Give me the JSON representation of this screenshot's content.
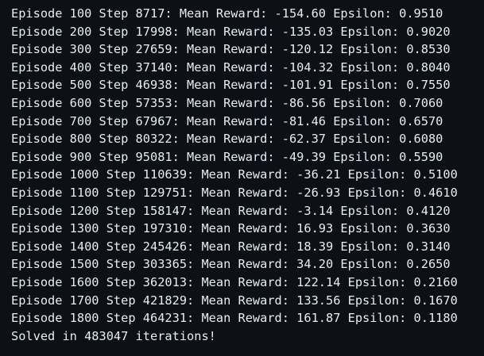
{
  "output": {
    "lines": [
      "Episode 100 Step 8717: Mean Reward: -154.60 Epsilon: 0.9510",
      "Episode 200 Step 17998: Mean Reward: -135.03 Epsilon: 0.9020",
      "Episode 300 Step 27659: Mean Reward: -120.12 Epsilon: 0.8530",
      "Episode 400 Step 37140: Mean Reward: -104.32 Epsilon: 0.8040",
      "Episode 500 Step 46938: Mean Reward: -101.91 Epsilon: 0.7550",
      "Episode 600 Step 57353: Mean Reward: -86.56 Epsilon: 0.7060",
      "Episode 700 Step 67967: Mean Reward: -81.46 Epsilon: 0.6570",
      "Episode 800 Step 80322: Mean Reward: -62.37 Epsilon: 0.6080",
      "Episode 900 Step 95081: Mean Reward: -49.39 Epsilon: 0.5590",
      "Episode 1000 Step 110639: Mean Reward: -36.21 Epsilon: 0.5100",
      "Episode 1100 Step 129751: Mean Reward: -26.93 Epsilon: 0.4610",
      "Episode 1200 Step 158147: Mean Reward: -3.14 Epsilon: 0.4120",
      "Episode 1300 Step 197310: Mean Reward: 16.93 Epsilon: 0.3630",
      "Episode 1400 Step 245426: Mean Reward: 18.39 Epsilon: 0.3140",
      "Episode 1500 Step 303365: Mean Reward: 34.20 Epsilon: 0.2650",
      "Episode 1600 Step 362013: Mean Reward: 122.14 Epsilon: 0.2160",
      "Episode 1700 Step 421829: Mean Reward: 133.56 Epsilon: 0.1670",
      "Episode 1800 Step 464231: Mean Reward: 161.87 Epsilon: 0.1180",
      "Solved in 483047 iterations!"
    ]
  },
  "colors": {
    "background": "#0d1117",
    "text": "#e6edf3"
  }
}
